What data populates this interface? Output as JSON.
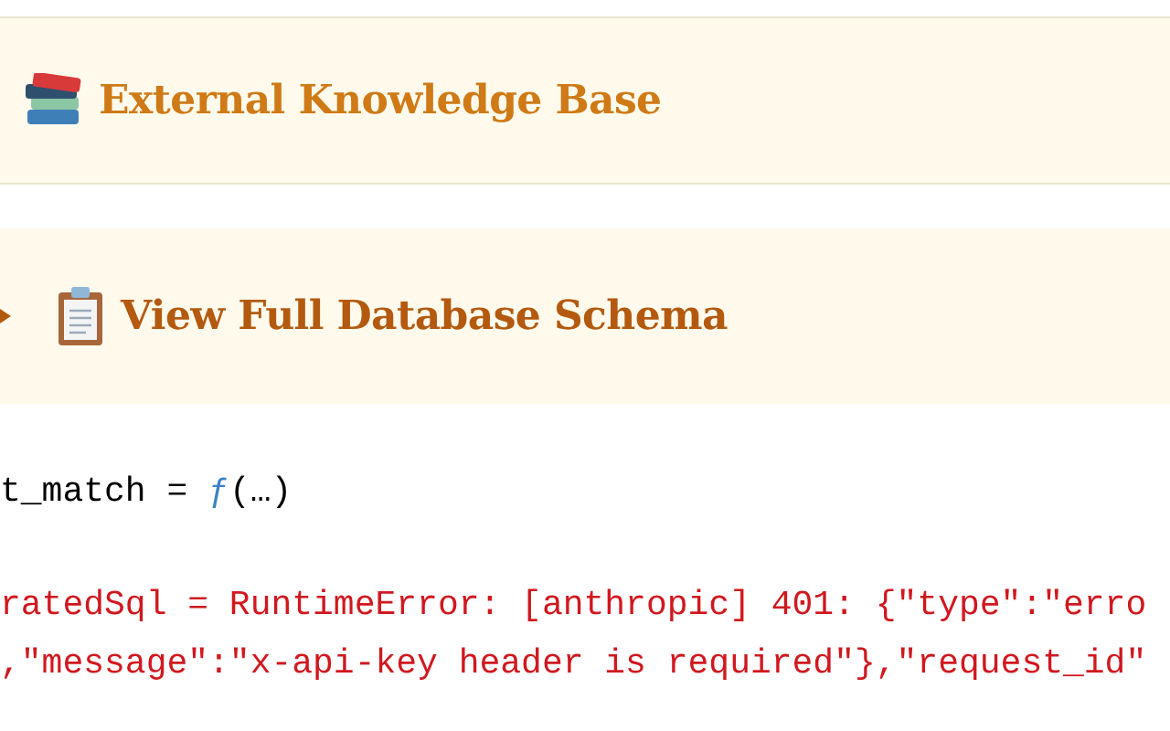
{
  "panels": [
    {
      "kind": "section",
      "title": "External Knowledge Base"
    },
    {
      "kind": "details",
      "title": "View Full Database Schema",
      "expanded": false
    }
  ],
  "cells": [
    {
      "kind": "value",
      "name": "t_match =",
      "fn": "ƒ",
      "args": "(…)"
    },
    {
      "kind": "error",
      "lines": [
        "ratedSql = RuntimeError: [anthropic] 401: {\"type\":\"erro",
        ",\"message\":\"x-api-key header is required\"},\"request_id\""
      ]
    }
  ]
}
